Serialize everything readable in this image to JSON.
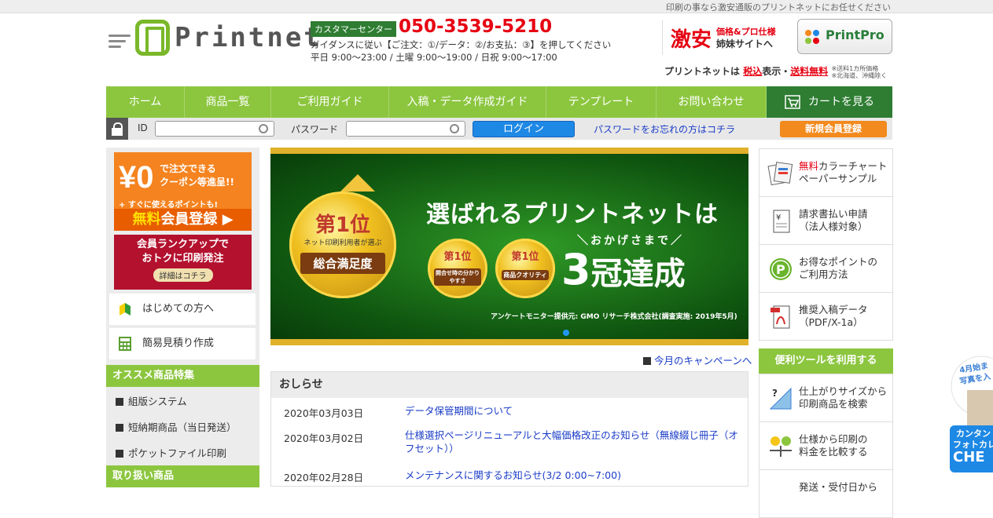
{
  "topbar": {
    "tagline": "印刷の事なら激安通販のプリントネットにお任せください"
  },
  "logo": {
    "name": "Printnet"
  },
  "contact": {
    "center_label": "カスタマーセンター",
    "phone": "050-3539-5210",
    "guidance": "ガイダンスに従い【ご注文：①/データ：②/お支払：③】を押してください",
    "hours": "平日 9:00～23:00 / 土曜 9:00～19:00 / 日祝 9:00～17:00"
  },
  "sister": {
    "big": "激安",
    "line1": "価格&プロ仕様",
    "line2": "姉妹サイトへ",
    "brand": "PrintPro"
  },
  "tax": {
    "prefix": "プリントネットは",
    "red1": "税込",
    "mid1": "表示・",
    "red2": "送料無料",
    "note1": "※送料1カ所価格",
    "note2": "※北海道、沖縄除く"
  },
  "nav": {
    "items": [
      "ホーム",
      "商品一覧",
      "ご利用ガイド",
      "入稿・データ作成ガイド",
      "テンプレート",
      "お問い合わせ"
    ],
    "cart": "カートを見る"
  },
  "login": {
    "id_label": "ID",
    "password_label": "パスワード",
    "login_button": "ログイン",
    "forgot": "パスワードをお忘れの方はコチラ",
    "register": "新規会員登録",
    "id_value": "",
    "password_value": ""
  },
  "left": {
    "banner1": {
      "yen": "¥0",
      "line1": "で注文できる",
      "line2": "クーポン等進呈!!",
      "line3": "+ すぐに使えるポイントも!",
      "cta_y": "無料",
      "cta": "会員登録"
    },
    "banner2": {
      "line1": "会員ランクアップで",
      "line2": "おトクに印刷発注",
      "cta": "詳細はコチラ"
    },
    "btn_first": "はじめての方へ",
    "btn_estimate": "簡易見積り作成",
    "sec_recommend": "オススメ商品特集",
    "links": [
      "組版システム",
      "短納期商品（当日発送）",
      "ポケットファイル印刷"
    ],
    "sec_products": "取り扱い商品"
  },
  "hero": {
    "medal_big_top": "第1位",
    "medal_big_sub": "ネット印刷利用者が選ぶ",
    "medal_big_label": "総合満足度",
    "medal_s1_top": "第1位",
    "medal_s1_label": "開合せ時の分かりやすさ",
    "medal_s2_top": "第1位",
    "medal_s2_label": "商品クオリティ",
    "title": "選ばれるプリントネットは",
    "sub": "＼おかげさまで／",
    "big_num": "3",
    "big_text": "冠達成",
    "note": "アンケートモニター提供元: GMO リサーチ株式会社(調査実施: 2019年5月)"
  },
  "campaign": "今月のキャンペーンへ",
  "news": {
    "title": "おしらせ",
    "items": [
      {
        "date": "2020年03月03日",
        "text": "データ保管期間について"
      },
      {
        "date": "2020年03月02日",
        "text": "仕様選択ページリニューアルと大幅価格改正のお知らせ（無線綴じ冊子（オフセット））"
      },
      {
        "date": "2020年02月28日",
        "text": "メンテナンスに関するお知らせ(3/2 0:00~7:00)"
      }
    ]
  },
  "right": {
    "boxes": [
      {
        "red": "無料",
        "line1": "カラーチャート",
        "line2": "ペーパーサンプル"
      },
      {
        "line1": "請求書払い申請",
        "line2": "（法人様対象）"
      },
      {
        "line1": "お得なポイントの",
        "line2": "ご利用方法"
      },
      {
        "line1": "推奨入稿データ",
        "line2": "（PDF/X-1a）"
      }
    ],
    "tools_sec": "便利ツールを利用する",
    "tools": [
      {
        "line1": "仕上がりサイズから",
        "line2": "印刷商品を検索"
      },
      {
        "line1": "仕様から印刷の",
        "line2": "料金を比較する"
      },
      {
        "line1": "発送・受付日から",
        "line2": ""
      }
    ]
  },
  "side_ad": {
    "l1": "4月始ま",
    "l2": "写真を入",
    "l3": "カンタン",
    "l4": "フォトカレ",
    "l5": "CHE"
  },
  "colors": {
    "green": "#8cc63f",
    "dark_green": "#2e7d32",
    "red": "#e60012",
    "orange": "#f28a1e",
    "link": "#1a3cc8"
  }
}
